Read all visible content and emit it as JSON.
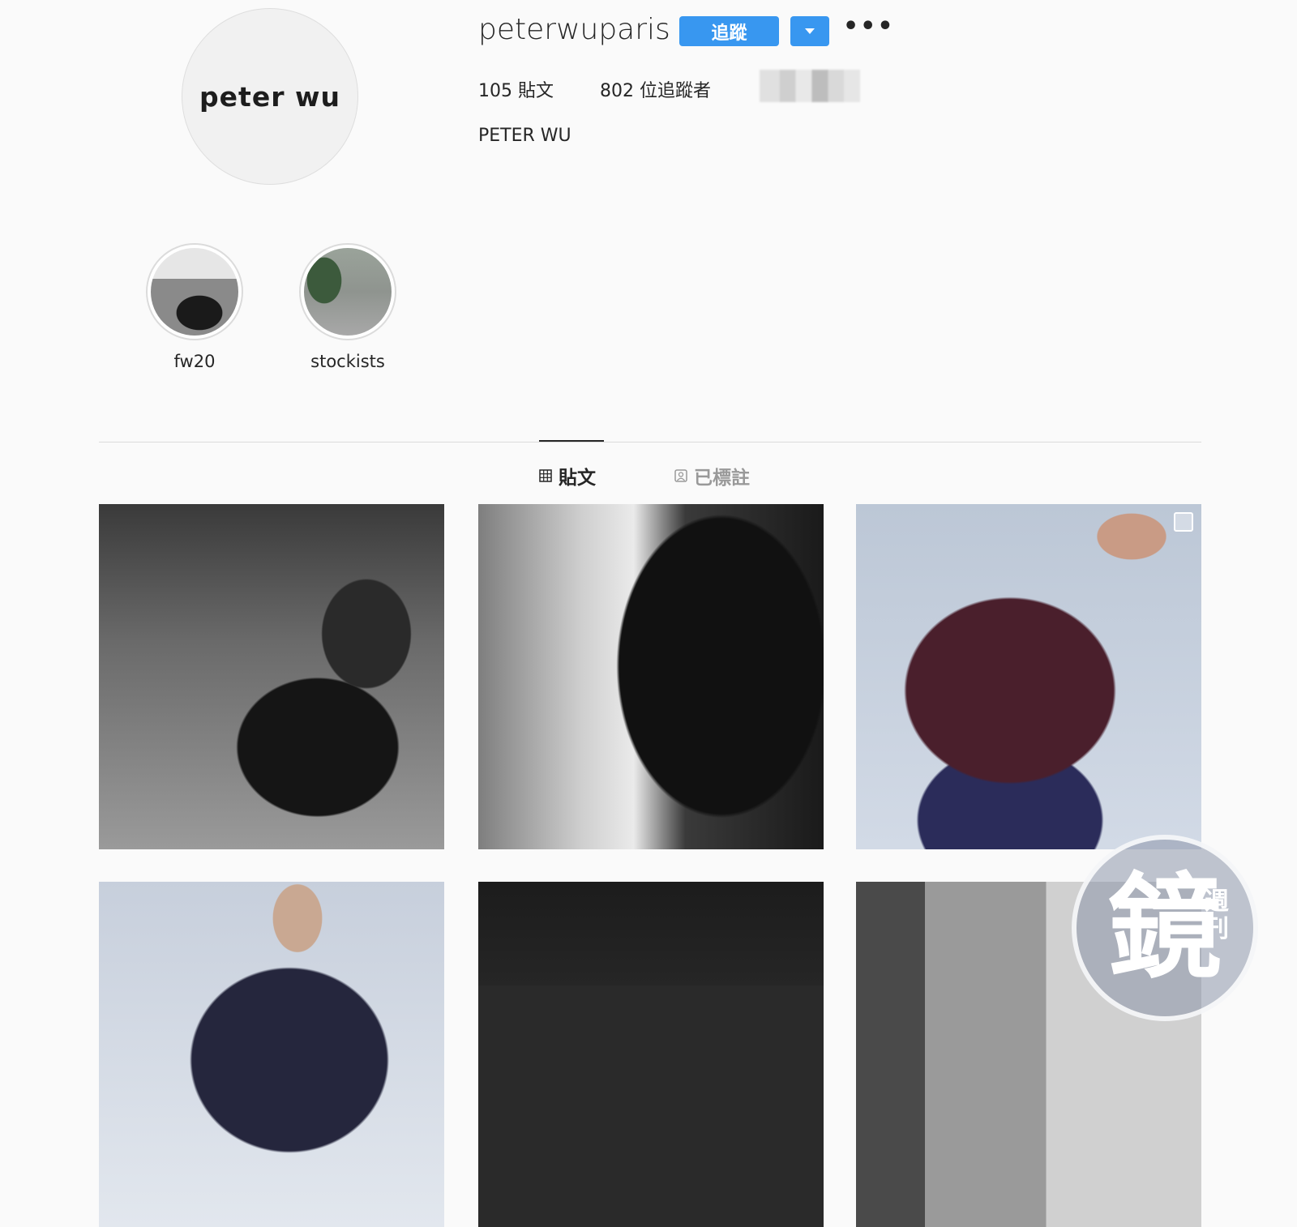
{
  "profile": {
    "avatar_text": "peter wu",
    "username": "peterwuparis",
    "follow_label": "追蹤",
    "more_label": "•••",
    "posts_stat": "105 貼文",
    "followers_stat": "802 位追蹤者",
    "full_name": "PETER WU"
  },
  "highlights": [
    {
      "label": "fw20"
    },
    {
      "label": "stockists"
    }
  ],
  "tabs": [
    {
      "label": "貼文",
      "icon": "grid-icon",
      "active": true
    },
    {
      "label": "已標註",
      "icon": "tagged-icon",
      "active": false
    }
  ],
  "watermark": {
    "big": "鏡",
    "small": "週刊"
  },
  "colors": {
    "accent": "#3897f0",
    "background": "#fafafa"
  }
}
